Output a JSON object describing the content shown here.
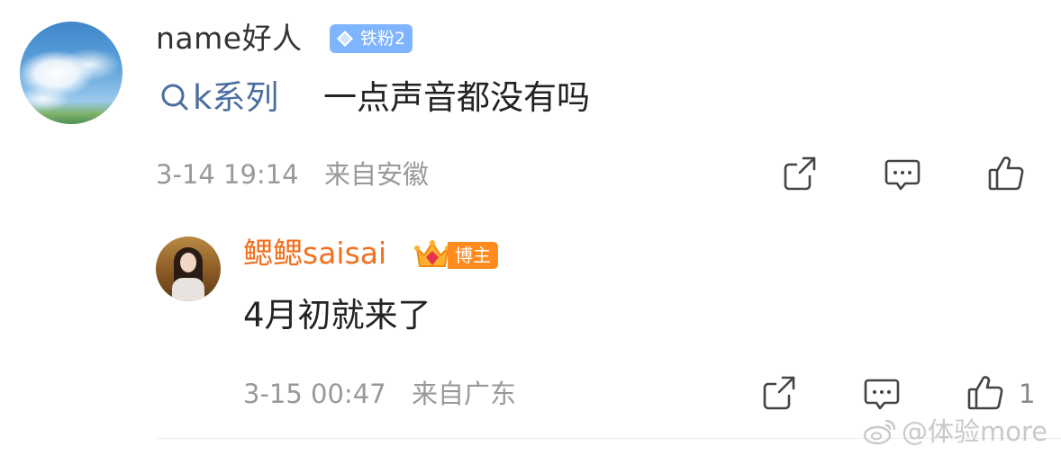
{
  "comment": {
    "username": "name好人",
    "badge": {
      "icon": "diamond-icon",
      "label": "铁粉2",
      "color": "#7fb4ff"
    },
    "topic": "k系列",
    "text": "一点声音都没有吗",
    "time": "3-14 19:14",
    "location": "来自安徽",
    "actions": [
      "share-icon",
      "comment-icon",
      "like-icon"
    ]
  },
  "reply": {
    "username": "鳃鳃saisai",
    "badge": {
      "icon": "crown-icon",
      "label": "博主",
      "color": "#ff8a1d"
    },
    "text": "4月初就来了",
    "time": "3-15 00:47",
    "location": "来自广东",
    "like_count": "1",
    "actions": [
      "share-icon",
      "comment-icon",
      "like-icon"
    ]
  },
  "watermark": {
    "icon": "weibo-icon",
    "text": "@体验more"
  },
  "colors": {
    "accent_orange": "#f36f1e",
    "topic_blue": "#4a6e9f",
    "meta_gray": "#999999"
  }
}
